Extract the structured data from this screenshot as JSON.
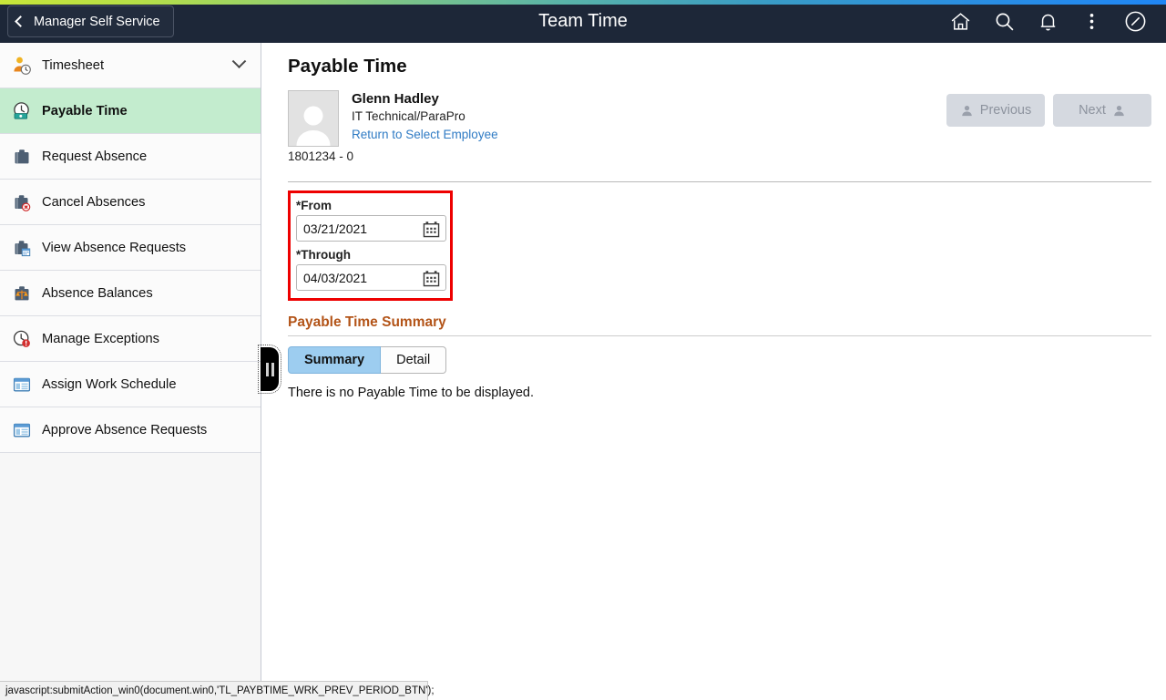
{
  "header": {
    "back_label": "Manager Self Service",
    "title": "Team Time",
    "icons": [
      {
        "name": "home-icon",
        "label": "Home"
      },
      {
        "name": "search-icon",
        "label": "Search"
      },
      {
        "name": "notifications-bell-icon",
        "label": "Notifications"
      },
      {
        "name": "actions-menu-icon",
        "label": "Actions"
      },
      {
        "name": "navigator-compass-icon",
        "label": "Navigator"
      }
    ]
  },
  "sidebar": {
    "items": [
      {
        "label": "Timesheet",
        "icon": "person-clock-icon",
        "selected": false,
        "expandable": true
      },
      {
        "label": "Payable Time",
        "icon": "clock-money-icon",
        "selected": true,
        "expandable": false
      },
      {
        "label": "Request Absence",
        "icon": "briefcase-icon",
        "selected": false,
        "expandable": false
      },
      {
        "label": "Cancel Absences",
        "icon": "briefcase-cancel-icon",
        "selected": false,
        "expandable": false
      },
      {
        "label": "View Absence Requests",
        "icon": "briefcase-calendar-icon",
        "selected": false,
        "expandable": false
      },
      {
        "label": "Absence Balances",
        "icon": "briefcase-scales-icon",
        "selected": false,
        "expandable": false
      },
      {
        "label": "Manage Exceptions",
        "icon": "clock-alert-icon",
        "selected": false,
        "expandable": false
      },
      {
        "label": "Assign Work Schedule",
        "icon": "window-schedule-icon",
        "selected": false,
        "expandable": false
      },
      {
        "label": "Approve Absence Requests",
        "icon": "window-schedule-icon",
        "selected": false,
        "expandable": false
      }
    ],
    "collapse_handle": "sidebar-collapse-handle"
  },
  "main": {
    "page_title": "Payable Time",
    "employee": {
      "name": "Glenn Hadley",
      "job_title": "IT Technical/ParaPro",
      "return_link": "Return to Select Employee",
      "employee_id": "1801234 - 0"
    },
    "previous_button": "Previous",
    "next_button": "Next",
    "date_filter": {
      "from_label": "*From",
      "from_value": "03/21/2021",
      "through_label": "*Through",
      "through_value": "04/03/2021",
      "highlight_color": "#ee0000"
    },
    "summary_section": {
      "heading": "Payable Time Summary",
      "tabs": [
        {
          "label": "Summary",
          "active": true
        },
        {
          "label": "Detail",
          "active": false
        }
      ],
      "empty_message": "There is no Payable Time to be displayed."
    }
  },
  "status_bar": {
    "text": "javascript:submitAction_win0(document.win0,'TL_PAYBTIME_WRK_PREV_PERIOD_BTN');"
  },
  "colors": {
    "header_bg": "#1d2738",
    "selected_nav": "#c3ecce",
    "section_heading": "#b35418",
    "link": "#2f7bc4",
    "active_tab": "#9dcdf0"
  }
}
